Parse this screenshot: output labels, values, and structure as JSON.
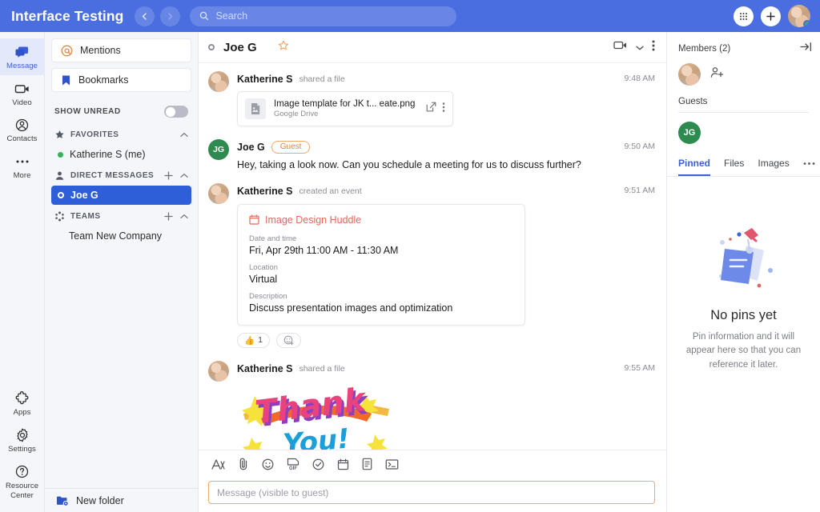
{
  "topbar": {
    "app_title": "Interface Testing",
    "back_icon": "chevron-left-icon",
    "forward_icon": "chevron-right-icon",
    "search_placeholder": "Search",
    "search_icon": "search-icon",
    "apps_icon": "grid-apps-icon",
    "add_icon": "plus-icon",
    "avatar_icon": "user-avatar",
    "status": "online",
    "brand_color": "#4a6ee0"
  },
  "rail": {
    "items": [
      {
        "label": "Message",
        "icon": "message-icon",
        "active": true
      },
      {
        "label": "Video",
        "icon": "video-camera-icon",
        "active": false
      },
      {
        "label": "Contacts",
        "icon": "contacts-icon",
        "active": false
      },
      {
        "label": "More",
        "icon": "more-dots-icon",
        "active": false
      }
    ],
    "bottom_items": [
      {
        "label": "Apps",
        "icon": "puzzle-piece-icon"
      },
      {
        "label": "Settings",
        "icon": "gear-icon"
      },
      {
        "label": "Resource Center",
        "label_line1": "Resource",
        "label_line2": "Center",
        "icon": "question-circle-icon"
      }
    ]
  },
  "sidebar": {
    "mentions": {
      "label": "Mentions",
      "icon": "at-mention-icon",
      "color": "#ed8336"
    },
    "bookmarks": {
      "label": "Bookmarks",
      "icon": "bookmark-icon",
      "color": "#2f53c9"
    },
    "show_unread": {
      "label": "SHOW UNREAD",
      "enabled": false
    },
    "favorites": {
      "label": "FAVORITES",
      "icon": "star-icon",
      "items": [
        {
          "label": "Katherine S (me)",
          "presence": "available"
        }
      ]
    },
    "direct_messages": {
      "label": "DIRECT MESSAGES",
      "icon": "person-icon",
      "add_icon": "plus-icon",
      "collapse_icon": "chevron-up-icon",
      "items": [
        {
          "label": "Joe G",
          "presence": "offline",
          "selected": true
        }
      ]
    },
    "teams": {
      "label": "TEAMS",
      "icon": "teams-icon",
      "add_icon": "plus-icon",
      "collapse_icon": "chevron-up-icon",
      "items": [
        {
          "label": "Team New Company"
        }
      ]
    },
    "new_folder": {
      "label": "New folder",
      "icon": "new-folder-icon"
    }
  },
  "chat": {
    "header": {
      "title": "Joe G",
      "presence": "offline",
      "star_icon": "star-outline-icon",
      "video_icon": "video-camera-icon",
      "video_dropdown_icon": "chevron-down-icon",
      "more_icon": "kebab-menu-icon"
    },
    "messages": [
      {
        "author": "Katherine S",
        "action": "shared a file",
        "time": "9:48 AM",
        "avatar": "photo",
        "type": "file",
        "file": {
          "name": "Image template for JK t... eate.png",
          "source": "Google Drive",
          "icon": "image-file-icon",
          "open_icon": "external-link-icon",
          "more_icon": "kebab-menu-icon"
        }
      },
      {
        "author": "Joe G",
        "badge": "Guest",
        "time": "9:50 AM",
        "avatar": "JG",
        "type": "text",
        "text": "Hey, taking a look now. Can you schedule a meeting for us to discuss further?"
      },
      {
        "author": "Katherine S",
        "action": "created an event",
        "time": "9:51 AM",
        "avatar": "photo",
        "type": "event",
        "event": {
          "title": "Image Design Huddle",
          "icon": "calendar-icon",
          "fields": [
            {
              "label": "Date and time",
              "value": "Fri, Apr 29th 11:00 AM - 11:30 AM"
            },
            {
              "label": "Location",
              "value": "Virtual"
            },
            {
              "label": "Description",
              "value": "Discuss presentation images and optimization"
            }
          ]
        },
        "reactions": [
          {
            "emoji": "👍",
            "count": "1"
          }
        ],
        "add_reaction_icon": "add-reaction-icon"
      },
      {
        "author": "Katherine S",
        "action": "shared a file",
        "time": "9:55 AM",
        "avatar": "photo",
        "type": "image",
        "image_alt": "Thank You!"
      }
    ]
  },
  "composer": {
    "tools": [
      {
        "icon": "format-text-icon"
      },
      {
        "icon": "attachment-icon"
      },
      {
        "icon": "emoji-icon"
      },
      {
        "icon": "gif-icon",
        "label": "GIF"
      },
      {
        "icon": "task-check-icon"
      },
      {
        "icon": "calendar-icon"
      },
      {
        "icon": "note-file-icon"
      },
      {
        "icon": "screen-share-icon"
      }
    ],
    "placeholder": "Message (visible to guest)",
    "border_color": "#f0a868"
  },
  "right_panel": {
    "members_title": "Members (2)",
    "collapse_icon": "collapse-right-icon",
    "add_member_icon": "add-person-icon",
    "guests_label": "Guests",
    "guest_initials": "JG",
    "tabs": [
      {
        "label": "Pinned",
        "active": true
      },
      {
        "label": "Files",
        "active": false
      },
      {
        "label": "Images",
        "active": false
      }
    ],
    "tabs_more_icon": "more-dots-icon",
    "empty": {
      "illustration": "pinned-note-icon",
      "title": "No pins yet",
      "text": "Pin information and it will appear here so that you can reference it later."
    }
  }
}
